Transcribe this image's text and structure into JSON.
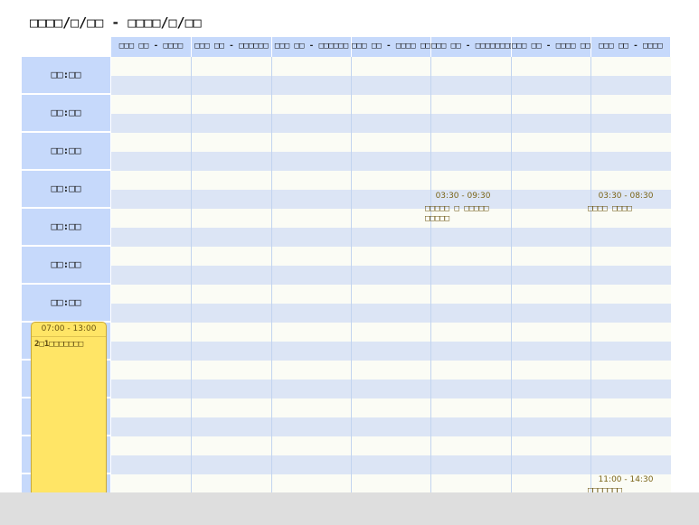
{
  "calendar": {
    "title": "□□□□/□/□□ - □□□□/□/□□",
    "days": [
      "□□□ □□ - □□□□",
      "□□□ □□ - □□□□□□",
      "□□□ □□ - □□□□□□",
      "□□□ □□ - □□□□ □□",
      "□□□ □□ - □□□□□□□□",
      "□□□ □□ - □□□□ □□□",
      "□□□ □□ - □□□□"
    ],
    "times": [
      "□□:□□",
      "□□:□□",
      "□□:□□",
      "□□:□□",
      "□□:□□",
      "□□:□□",
      "□□:□□"
    ],
    "events": [
      {
        "time": "07:00 - 13:00",
        "title": "2□1□□□□□□□",
        "color": "#ffe566"
      },
      {
        "time": "03:30 - 09:30",
        "title": "□□□□□ □ □□□□□ □□□□□",
        "color": "#7a6418"
      },
      {
        "time": "03:30 - 08:30",
        "title": "□□□□ □□□□",
        "color": "#7a6418"
      },
      {
        "time": "11:00 - 14:30",
        "title": "□□□□□□□",
        "color": "#7a6418"
      }
    ]
  },
  "colors": {
    "header_bg": "#c6d9fb",
    "row_blue": "#dce5f5",
    "row_light": "#fbfcf5",
    "event_text": "#7a6418"
  }
}
